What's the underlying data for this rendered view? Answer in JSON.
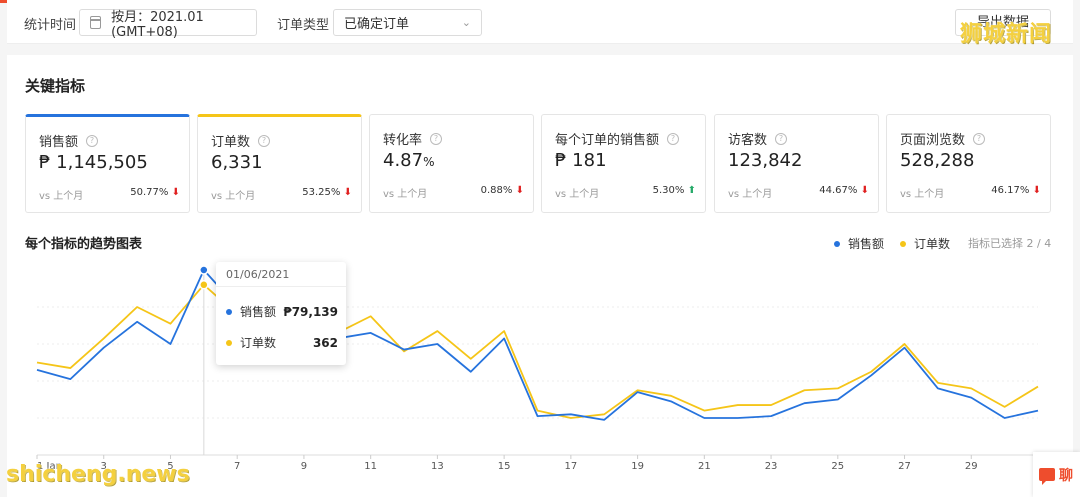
{
  "filters": {
    "period_label": "统计时间",
    "period_value": "按月：2021.01 (GMT+08)",
    "order_type_label": "订单类型",
    "order_type_value": "已确定订单",
    "export_label": "导出数据"
  },
  "watermark_top": "狮城新闻",
  "watermark_bottom": "shicheng.news",
  "key_metrics": {
    "title": "关键指标",
    "cards": [
      {
        "label": "销售额",
        "value": "₱ 1,145,505",
        "vs": "vs 上个月",
        "change": "50.77%",
        "trend": "down"
      },
      {
        "label": "订单数",
        "value": "6,331",
        "vs": "vs 上个月",
        "change": "53.25%",
        "trend": "down"
      },
      {
        "label": "转化率",
        "value": "4.87",
        "unit": "%",
        "vs": "vs 上个月",
        "change": "0.88%",
        "trend": "down"
      },
      {
        "label": "每个订单的销售额",
        "value": "₱ 181",
        "vs": "vs 上个月",
        "change": "5.30%",
        "trend": "up"
      },
      {
        "label": "访客数",
        "value": "123,842",
        "vs": "vs 上个月",
        "change": "44.67%",
        "trend": "down"
      },
      {
        "label": "页面浏览数",
        "value": "528,288",
        "vs": "vs 上个月",
        "change": "46.17%",
        "trend": "down"
      }
    ]
  },
  "trend": {
    "title": "每个指标的趋势图表",
    "selected_note": "指标已选择 2 / 4",
    "tooltip": {
      "date": "01/06/2021",
      "rows": [
        {
          "name": "销售额",
          "value": "₱79,139"
        },
        {
          "name": "订单数",
          "value": "362"
        }
      ]
    }
  },
  "chat_label": "聊",
  "colors": {
    "sales": "#2673dd",
    "orders": "#f5c518",
    "accent": "#ee4d2d"
  },
  "chart_data": {
    "type": "line",
    "x": [
      1,
      2,
      3,
      4,
      5,
      6,
      7,
      8,
      9,
      10,
      11,
      12,
      13,
      14,
      15,
      16,
      17,
      18,
      19,
      20,
      21,
      22,
      23,
      24,
      25,
      26,
      27,
      28,
      29,
      30,
      31
    ],
    "xtick_labels": [
      "1 Jan",
      "3",
      "5",
      "7",
      "9",
      "11",
      "13",
      "15",
      "17",
      "19",
      "21",
      "23",
      "25",
      "27",
      "29"
    ],
    "xtick_values": [
      1,
      3,
      5,
      7,
      9,
      11,
      13,
      15,
      17,
      19,
      21,
      23,
      25,
      27,
      29
    ],
    "ylim": [
      0,
      100
    ],
    "grid": true,
    "legend_position": "top-right",
    "series": [
      {
        "name": "销售额",
        "values": [
          46,
          41,
          58,
          72,
          60,
          100,
          80,
          62,
          58,
          63,
          66,
          57,
          60,
          45,
          63,
          21,
          22,
          19,
          34,
          29,
          20,
          20,
          21,
          28,
          30,
          43,
          58,
          36,
          31,
          20,
          24
        ]
      },
      {
        "name": "订单数",
        "values": [
          50,
          47,
          63,
          80,
          71,
          92,
          76,
          66,
          62,
          66,
          75,
          56,
          67,
          52,
          67,
          24,
          20,
          22,
          35,
          32,
          24,
          27,
          27,
          35,
          36,
          45,
          60,
          39,
          36,
          26,
          37
        ]
      }
    ]
  }
}
